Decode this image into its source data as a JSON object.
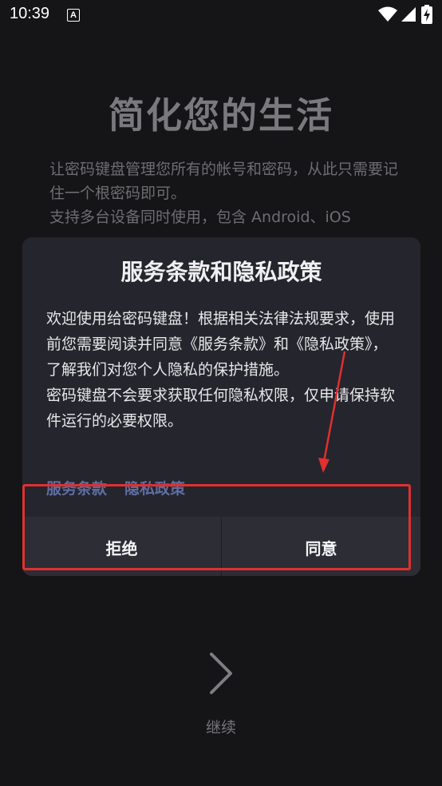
{
  "status_bar": {
    "time": "10:39",
    "notification_icon": "A"
  },
  "background": {
    "title": "简化您的生活",
    "description": [
      "让密码键盘管理您所有的帐号和密码，从此只需要记住一个根密码即可。",
      "支持多台设备同时使用，包含 Android、iOS"
    ],
    "continue_label": "继续"
  },
  "dialog": {
    "title": "服务条款和隐私政策",
    "paragraphs": [
      "欢迎使用给密码键盘！根据相关法律法规要求，使用前您需要阅读并同意《服务条款》和《隐私政策》，了解我们对您个人隐私的保护措施。",
      "密码键盘不会要求获取任何隐私权限，仅申请保持软件运行的必要权限。"
    ],
    "links": {
      "terms": "服务条款",
      "privacy": "隐私政策"
    },
    "buttons": {
      "reject": "拒绝",
      "agree": "同意"
    }
  },
  "colors": {
    "background": "#151517",
    "dialog": "#25252d",
    "link": "#5f6fa3",
    "annotation": "#e0302f"
  }
}
